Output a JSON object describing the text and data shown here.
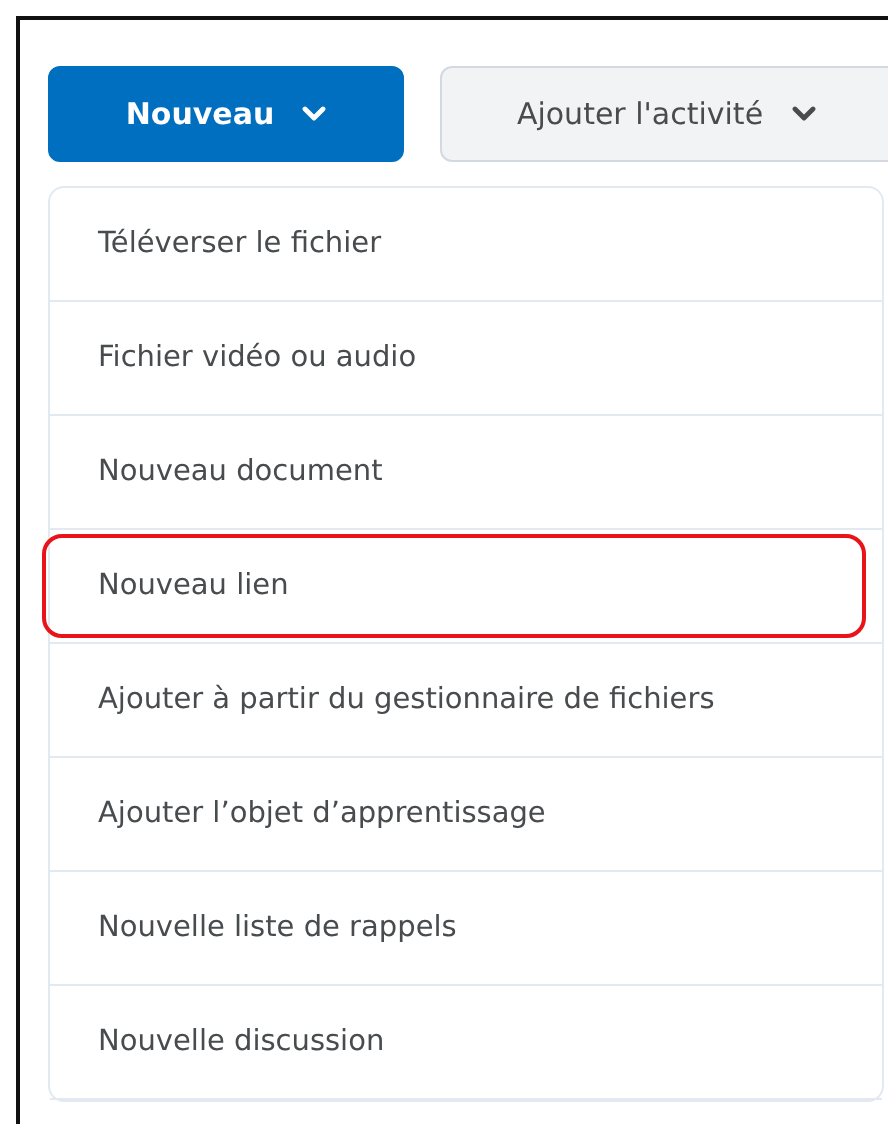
{
  "toolbar": {
    "buttons": [
      {
        "label": "Nouveau",
        "kind": "primary"
      },
      {
        "label": "Ajouter l'activité",
        "kind": "secondary"
      }
    ]
  },
  "menu": {
    "items": [
      {
        "label": "Téléverser le fichier",
        "highlighted": false
      },
      {
        "label": "Fichier vidéo ou audio",
        "highlighted": false
      },
      {
        "label": "Nouveau document",
        "highlighted": false
      },
      {
        "label": "Nouveau lien",
        "highlighted": true
      },
      {
        "label": "Ajouter à partir du gestionnaire de fichiers",
        "highlighted": false
      },
      {
        "label": "Ajouter l’objet d’apprentissage",
        "highlighted": false
      },
      {
        "label": "Nouvelle liste de rappels",
        "highlighted": false
      },
      {
        "label": "Nouvelle discussion",
        "highlighted": false
      }
    ]
  }
}
